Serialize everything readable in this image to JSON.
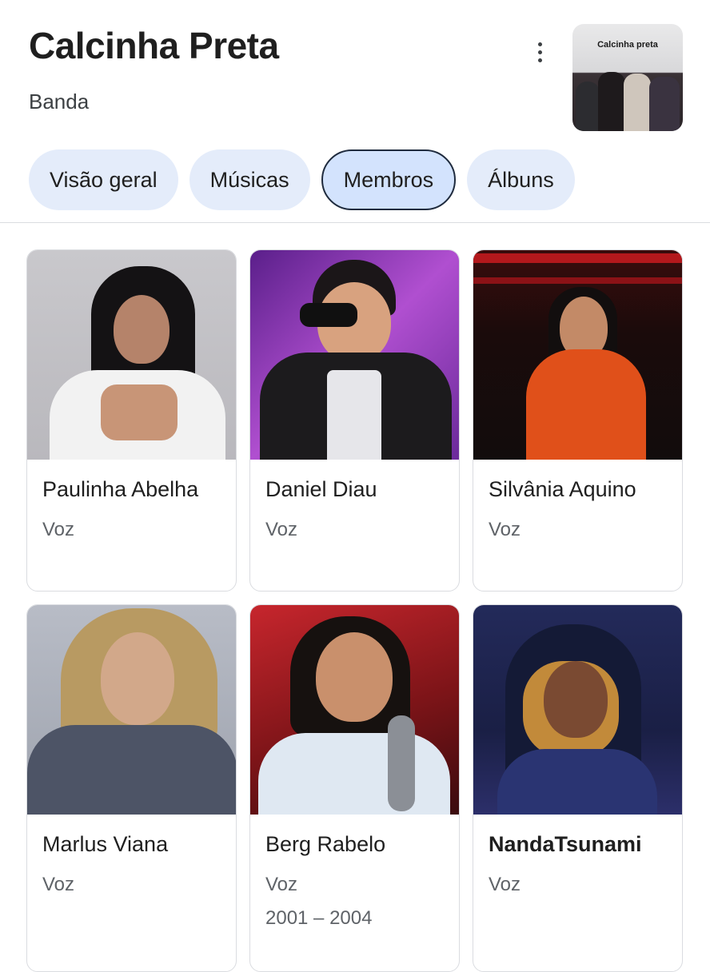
{
  "header": {
    "title": "Calcinha Preta",
    "subtitle": "Banda",
    "thumbnail_label": "Calcinha preta"
  },
  "tabs": [
    {
      "label": "Visão geral",
      "active": false
    },
    {
      "label": "Músicas",
      "active": false
    },
    {
      "label": "Membros",
      "active": true
    },
    {
      "label": "Álbuns",
      "active": false
    }
  ],
  "members": [
    {
      "name": "Paulinha Abelha",
      "role": "Voz"
    },
    {
      "name": "Daniel Diau",
      "role": "Voz"
    },
    {
      "name": "Silvânia Aquino",
      "role": "Voz"
    },
    {
      "name": "Marlus Viana",
      "role": "Voz"
    },
    {
      "name": "Berg Rabelo",
      "role": "Voz",
      "years": "2001 – 2004"
    },
    {
      "name": "NandaTsunami",
      "role": "Voz"
    }
  ],
  "colors": {
    "tab_background": "#e4ecfa",
    "tab_active_background": "#d3e3fd",
    "tab_active_border": "#1f2b3e"
  },
  "icons": [
    "more-vert-icon"
  ]
}
